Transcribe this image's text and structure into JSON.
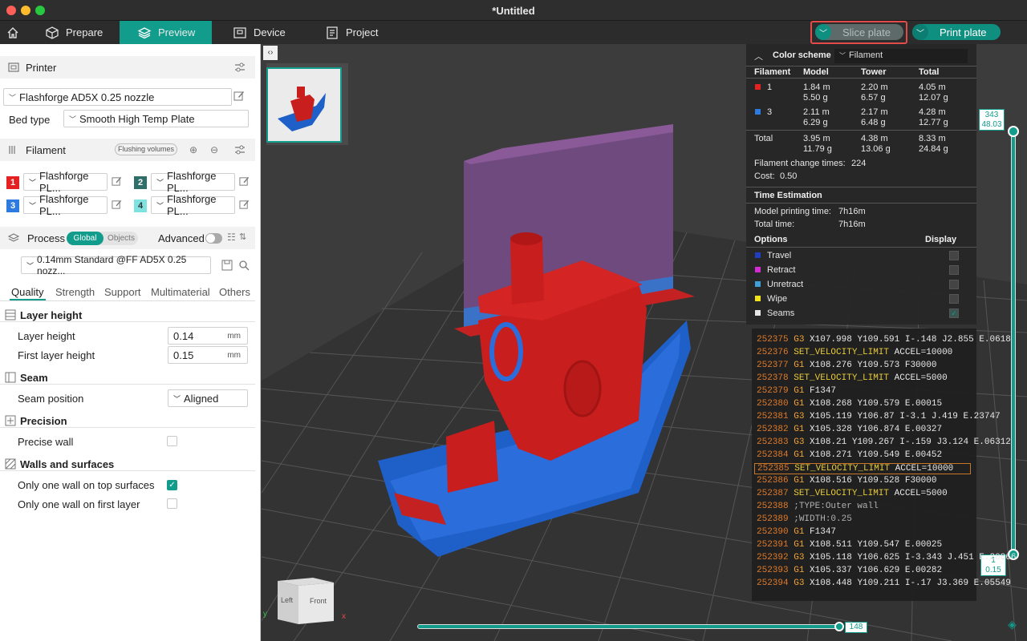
{
  "window": {
    "title": "*Untitled"
  },
  "nav": {
    "prepare": "Prepare",
    "preview": "Preview",
    "device": "Device",
    "project": "Project",
    "slice": "Slice plate",
    "print": "Print plate"
  },
  "printer": {
    "header": "Printer",
    "name": "Flashforge AD5X 0.25 nozzle",
    "bed_label": "Bed type",
    "bed_value": "Smooth High Temp Plate"
  },
  "filament": {
    "header": "Filament",
    "flushing": "Flushing volumes",
    "items": [
      {
        "num": "1",
        "name": "Flashforge PL...",
        "color": "#e52222"
      },
      {
        "num": "2",
        "name": "Flashforge PL...",
        "color": "#2f6f6a"
      },
      {
        "num": "3",
        "name": "Flashforge PL...",
        "color": "#2d7be0"
      },
      {
        "num": "4",
        "name": "Flashforge PL...",
        "color": "#7ee3e0"
      }
    ]
  },
  "process": {
    "header": "Process",
    "global": "Global",
    "objects": "Objects",
    "advanced": "Advanced",
    "profile": "0.14mm Standard @FF AD5X 0.25 nozz...",
    "tabs": [
      "Quality",
      "Strength",
      "Support",
      "Multimaterial",
      "Others"
    ]
  },
  "quality": {
    "layer_group": "Layer height",
    "layer_height_label": "Layer height",
    "layer_height": "0.14",
    "first_layer_label": "First layer height",
    "first_layer": "0.15",
    "unit": "mm",
    "seam_group": "Seam",
    "seam_pos_label": "Seam position",
    "seam_pos": "Aligned",
    "precision_group": "Precision",
    "precise_wall": "Precise wall",
    "walls_group": "Walls and surfaces",
    "one_wall_top": "Only one wall on top surfaces",
    "one_wall_first": "Only one wall on first layer"
  },
  "plate": {
    "number": "1"
  },
  "legend": {
    "title": "Color scheme",
    "scheme": "Filament",
    "cols": [
      "Filament",
      "Model",
      "Tower",
      "Total"
    ],
    "rows": [
      {
        "id": "1",
        "color": "#e52222",
        "model": [
          "1.84 m",
          "5.50 g"
        ],
        "tower": [
          "2.20 m",
          "6.57 g"
        ],
        "total": [
          "4.05 m",
          "12.07 g"
        ]
      },
      {
        "id": "3",
        "color": "#2d7be0",
        "model": [
          "2.11 m",
          "6.29 g"
        ],
        "tower": [
          "2.17 m",
          "6.48 g"
        ],
        "total": [
          "4.28 m",
          "12.77 g"
        ]
      },
      {
        "id": "Total",
        "color": "",
        "model": [
          "3.95 m",
          "11.79 g"
        ],
        "tower": [
          "4.38 m",
          "13.06 g"
        ],
        "total": [
          "8.33 m",
          "24.84 g"
        ]
      }
    ],
    "change_label": "Filament change times:",
    "change_val": "224",
    "cost_label": "Cost:",
    "cost_val": "0.50",
    "time_header": "Time Estimation",
    "model_time_label": "Model printing time:",
    "model_time": "7h16m",
    "total_time_label": "Total time:",
    "total_time": "7h16m",
    "options_header": "Options",
    "display_header": "Display",
    "options": [
      {
        "name": "Travel",
        "color": "#1f3fc0"
      },
      {
        "name": "Retract",
        "color": "#d42ad4"
      },
      {
        "name": "Unretract",
        "color": "#3fa0d8"
      },
      {
        "name": "Wipe",
        "color": "#f2e21a"
      },
      {
        "name": "Seams",
        "color": "#e6e6e6"
      }
    ]
  },
  "gcode": [
    {
      "n": "252375",
      "c": "G3",
      "a": "X107.998 Y109.591 I-.148 J2.855 E.0618"
    },
    {
      "n": "252376",
      "c": "SET_VELOCITY_LIMIT",
      "a": "ACCEL=10000"
    },
    {
      "n": "252377",
      "c": "G1",
      "a": "X108.276 Y109.573 F30000"
    },
    {
      "n": "252378",
      "c": "SET_VELOCITY_LIMIT",
      "a": "ACCEL=5000"
    },
    {
      "n": "252379",
      "c": "G1",
      "a": "F1347"
    },
    {
      "n": "252380",
      "c": "G1",
      "a": "X108.268 Y109.579 E.00015"
    },
    {
      "n": "252381",
      "c": "G3",
      "a": "X105.119 Y106.87 I-3.1 J.419 E.23747"
    },
    {
      "n": "252382",
      "c": "G1",
      "a": "X105.328 Y106.874 E.00327"
    },
    {
      "n": "252383",
      "c": "G3",
      "a": "X108.21 Y109.267 I-.159 J3.124 E.06312"
    },
    {
      "n": "252384",
      "c": "G1",
      "a": "X108.271 Y109.549 E.00452"
    },
    {
      "n": "252385",
      "c": "SET_VELOCITY_LIMIT",
      "a": "ACCEL=10000"
    },
    {
      "n": "252386",
      "c": "G1",
      "a": "X108.516 Y109.528 F30000"
    },
    {
      "n": "252387",
      "c": "SET_VELOCITY_LIMIT",
      "a": "ACCEL=5000"
    },
    {
      "n": "252388",
      "c": "",
      "a": ";TYPE:Outer wall"
    },
    {
      "n": "252389",
      "c": "",
      "a": ";WIDTH:0.25"
    },
    {
      "n": "252390",
      "c": "G1",
      "a": "F1347"
    },
    {
      "n": "252391",
      "c": "G1",
      "a": "X108.511 Y109.547 E.00025"
    },
    {
      "n": "252392",
      "c": "G3",
      "a": "X105.118 Y106.625 I-3.343 J.451 E.20866"
    },
    {
      "n": "252393",
      "c": "G1",
      "a": "X105.337 Y106.629 E.00282"
    },
    {
      "n": "252394",
      "c": "G3",
      "a": "X108.448 Y109.211 I-.17 J3.369 E.05549"
    }
  ],
  "slider": {
    "top_layer": "343",
    "top_height": "48.03",
    "bottom_layer": "1",
    "bottom_height": "0.15",
    "horizontal": "148"
  },
  "cube": {
    "left": "Left",
    "front": "Front",
    "x": "x",
    "y": "y"
  }
}
